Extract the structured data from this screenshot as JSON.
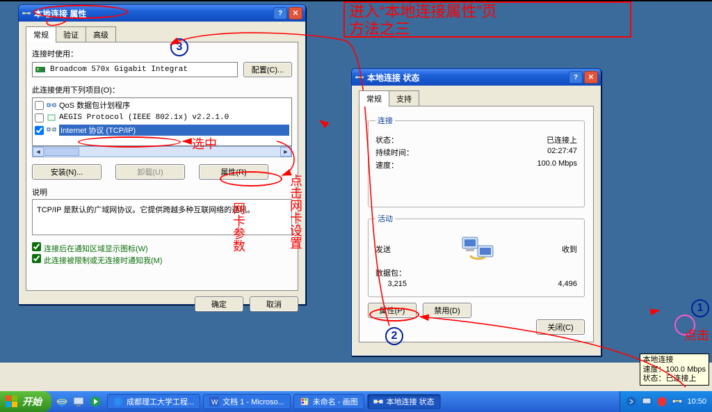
{
  "annotation": {
    "headline1": "进入“本地连接属性”页",
    "headline2": "方法之三",
    "select_note": "选中",
    "click_note_vert": "点击网卡设置",
    "click_note_r": "网卡参数",
    "click1": "点击"
  },
  "props": {
    "title": "本地连接 属性",
    "tabs": [
      "常规",
      "验证",
      "高级"
    ],
    "connect_using_label": "连接时使用：",
    "adapter": "Broadcom 570x Gigabit Integrat",
    "configure_btn": "配置(C)...",
    "items_label": "此连接使用下列项目(O)：",
    "items": [
      {
        "checked": false,
        "label": "QoS 数据包计划程序"
      },
      {
        "checked": false,
        "label": "AEGIS Protocol (IEEE 802.1x) v2.2.1.0"
      },
      {
        "checked": true,
        "label": "Internet 协议 (TCP/IP)",
        "selected": true
      }
    ],
    "install_btn": "安装(N)...",
    "uninstall_btn": "卸载(U)",
    "props_btn": "属性(R)",
    "desc_hdr": "说明",
    "desc_body": "TCP/IP 是默认的广域网协议。它提供跨越多种互联网络的通讯。",
    "cb1": "连接后在通知区域显示图标(W)",
    "cb2": "此连接被限制或无连接时通知我(M)",
    "ok": "确定",
    "cancel": "取消"
  },
  "status": {
    "title": "本地连接 状态",
    "tabs": [
      "常规",
      "支持"
    ],
    "grp_conn": "连接",
    "state_l": "状态：",
    "state_v": "已连接上",
    "dur_l": "持续时间：",
    "dur_v": "02:27:47",
    "spd_l": "速度：",
    "spd_v": "100.0 Mbps",
    "grp_act": "活动",
    "sent": "发送",
    "recv": "收到",
    "pkt_l": "数据包：",
    "pkt_sent": "3,215",
    "pkt_recv": "4,496",
    "props_btn": "属性(P)",
    "disable_btn": "禁用(D)",
    "close_btn": "关闭(C)"
  },
  "tooltip": {
    "l1": "本地连接",
    "l2": "速度：100.0 Mbps",
    "l3": "状态：已连接上"
  },
  "taskbar": {
    "start": "开始",
    "tasks": [
      "成都理工大学工程...",
      "文档 1 - Microso...",
      "未命名 - 画图",
      "本地连接 状态"
    ],
    "clock": "10:50"
  }
}
